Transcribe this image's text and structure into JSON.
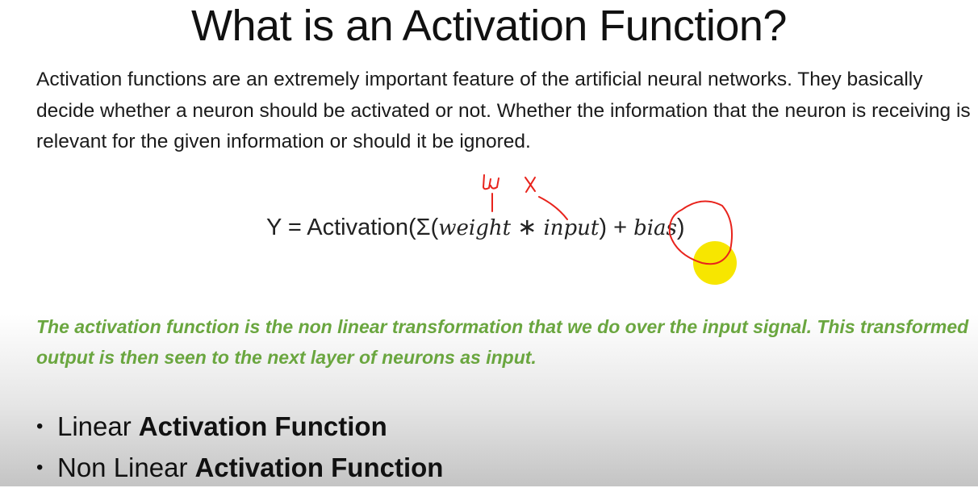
{
  "slide": {
    "title": "What is an Activation Function?",
    "paragraph": "Activation functions are an extremely important feature of the artificial neural networks. They basically decide whether a neuron should be activated or not. Whether the information that the neuron is receiving is relevant for the given information or should it be ignored.",
    "equation": {
      "prefix": "Y = Activation(Σ(",
      "weight": "weight",
      "times": " ∗ ",
      "input": "input",
      "mid": ") + ",
      "bias": "bias",
      "suffix": ")"
    },
    "annotations": {
      "w_label": "w",
      "x_label": "x",
      "highlight_color": "#f7e600",
      "ink_color": "#e8231c"
    },
    "highlight_text": "The activation function is the non linear transformation that we do over the input signal. This transformed output is then seen to the next layer of neurons as input.",
    "bullets": [
      {
        "plain": "Linear",
        "bold": "Activation Function"
      },
      {
        "plain": "Non Linear",
        "bold": "Activation Function"
      }
    ]
  }
}
